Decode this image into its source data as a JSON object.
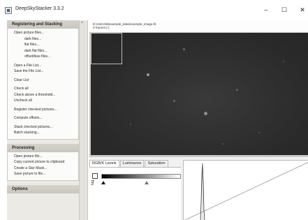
{
  "window": {
    "title": "DeepSkyStacker 3.3.2",
    "minimize_glyph": "–",
    "maximize_glyph": "☐",
    "close_glyph": "✕",
    "icon": "app-icon"
  },
  "sidebar": {
    "registering": {
      "header": "Registering and Stacking",
      "items": [
        "Open picture files...",
        "dark files...",
        "flat files...",
        "dark flat files...",
        "offset/bias files...",
        "Open a File List...",
        "Save the File List...",
        "Clear List",
        "Check all",
        "Check above a threshold...",
        "Uncheck all",
        "Register checked pictures...",
        "Compute offsets...",
        "Stack checked pictures...",
        "Batch stacking..."
      ]
    },
    "processing": {
      "header": "Processing",
      "items": [
        "Open picture file...",
        "Copy current picture to clipboard",
        "Create a Star Mask...",
        "Save picture to file..."
      ]
    },
    "options": {
      "header": "Options"
    }
  },
  "splitter": {
    "arrow_glyph": "^"
  },
  "file_info": {
    "path": "D:\\Astro\\M\\example_data\\example_image.fit",
    "frames": "0 frames (:)"
  },
  "panel": {
    "tabs": [
      "RGB/K Levels",
      "Luminance",
      "Saturation"
    ],
    "active_tab": "RGB/K Levels",
    "log_label": "log"
  },
  "colors": {
    "image_background": "#2c2c2c",
    "sidebar_header": "#cfccc4"
  }
}
